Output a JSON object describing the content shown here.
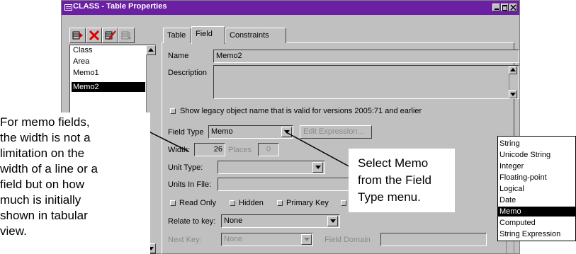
{
  "window": {
    "title": "CLASS - Table Properties",
    "title_color": "#6b1fa3"
  },
  "toolbar": {
    "icons": [
      "insert-column-icon",
      "delete-column-icon",
      "edit-column-icon",
      "column-order-icon"
    ]
  },
  "columns": {
    "items": [
      "Class",
      "Area",
      "Memo1",
      "Memo2"
    ],
    "selected": "Memo2"
  },
  "tabs": [
    "Table",
    "Field",
    "Constraints"
  ],
  "active_tab": "Field",
  "form": {
    "name_label": "Name",
    "name_value": "Memo2",
    "description_label": "Description",
    "legacy_checkbox_label": "Show legacy object name that is valid for versions 2005:71 and earlier",
    "field_type_label": "Field Type",
    "field_type_value": "Memo",
    "edit_expression_label": "Edit Expression...",
    "width_label": "Width:",
    "width_value": "26",
    "places_label": "Places",
    "places_value": "0",
    "unit_type_label": "Unit Type:",
    "units_in_file_label": "Units In File:",
    "read_only_label": "Read Only",
    "hidden_label": "Hidden",
    "primary_key_label": "Primary Key",
    "relate_to_key_label": "Relate to key:",
    "relate_to_key_value": "None",
    "next_key_label": "Next Key:",
    "next_key_value": "None",
    "field_domain_label": "Field Domain"
  },
  "field_type_menu": {
    "options": [
      "String",
      "Unicode String",
      "Integer",
      "Floating-point",
      "Logical",
      "Date",
      "Memo",
      "Computed",
      "String Expression"
    ],
    "selected": "Memo"
  },
  "callouts": {
    "left": [
      "For memo fields,",
      "the width is not a",
      "limitation on the",
      "width of a line or a",
      "field but on how",
      "much is initially",
      "shown in tabular",
      "view."
    ],
    "right": [
      "Select Memo",
      "from the Field",
      "Type menu."
    ]
  }
}
